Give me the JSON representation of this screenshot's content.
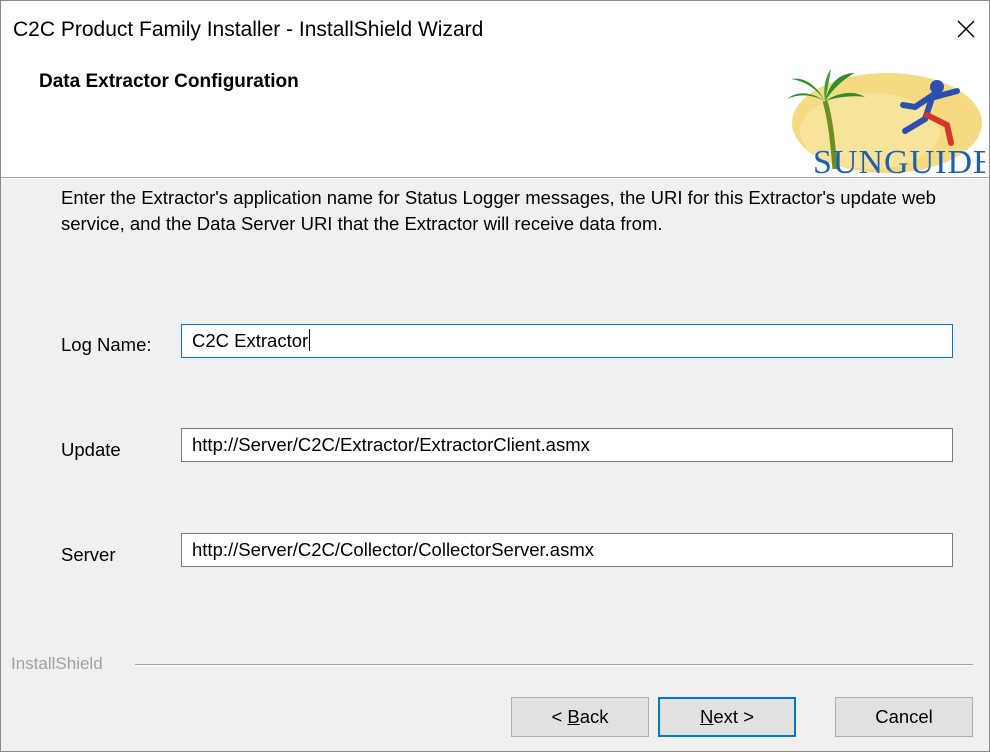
{
  "window": {
    "title": "C2C Product Family Installer - InstallShield Wizard",
    "close_symbol": "✕"
  },
  "header": {
    "title": "Data Extractor Configuration",
    "logo_text": "SUNGUIDE"
  },
  "description": "Enter the Extractor's application name for Status Logger messages, the URI for this Extractor's update web service, and the Data Server URI that the Extractor will receive data from.",
  "fields": {
    "log_name": {
      "label": "Log Name:",
      "value": "C2C Extractor"
    },
    "update": {
      "label": "Update",
      "value": "http://Server/C2C/Extractor/ExtractorClient.asmx"
    },
    "server": {
      "label": "Server",
      "value": "http://Server/C2C/Collector/CollectorServer.asmx"
    }
  },
  "footer": {
    "brand": "InstallShield"
  },
  "buttons": {
    "back_prefix": "< ",
    "back_accel": "B",
    "back_rest": "ack",
    "next_accel": "N",
    "next_rest": "ext >",
    "cancel": "Cancel"
  },
  "colors": {
    "focus_border": "#0078d7",
    "dialog_bg": "#f0f0f0",
    "logo_sun": "#f3d36b",
    "logo_palm": "#2f8f2f",
    "logo_figure": "#2a4fb0",
    "logo_text": "#1e5fb0"
  }
}
